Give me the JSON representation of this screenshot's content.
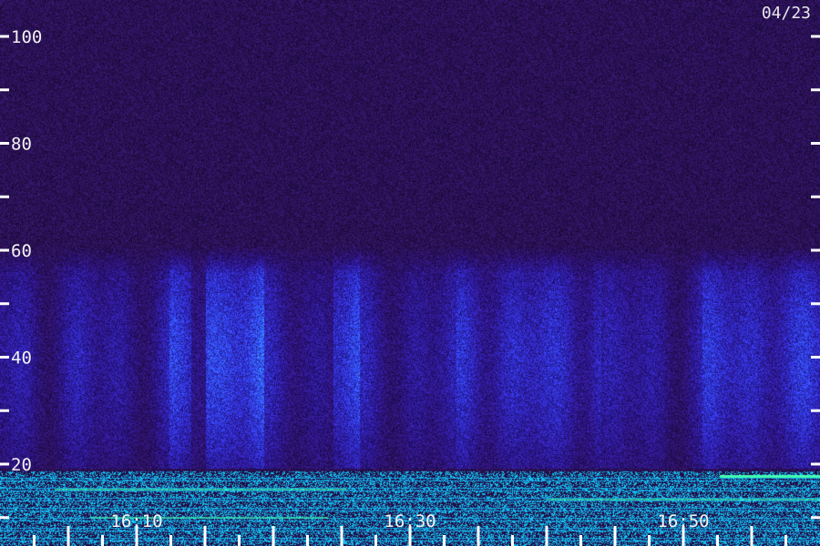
{
  "chart_data": {
    "type": "heatmap",
    "title": "",
    "xlabel": "",
    "ylabel": "",
    "date_label": "04/23",
    "y_axis": {
      "ticks": [
        10,
        20,
        30,
        40,
        50,
        60,
        70,
        80,
        90,
        100,
        110
      ],
      "labels": [
        {
          "value": 20,
          "text": "20"
        },
        {
          "value": 40,
          "text": "40"
        },
        {
          "value": 60,
          "text": "60"
        },
        {
          "value": 80,
          "text": "80"
        },
        {
          "value": 100,
          "text": "100"
        }
      ],
      "range": [
        3,
        105
      ]
    },
    "x_axis": {
      "range_minutes": [
        0,
        60
      ],
      "ticks_minutes": [
        2.5,
        5,
        7.5,
        10,
        12.5,
        15,
        17.5,
        20,
        22.5,
        25,
        27.5,
        30,
        32.5,
        35,
        37.5,
        40,
        42.5,
        45,
        47.5,
        50,
        52.5,
        55,
        57.5
      ],
      "labels": [
        {
          "value": 10,
          "text": "16:10"
        },
        {
          "value": 30,
          "text": "16:30"
        },
        {
          "value": 50,
          "text": "16:50"
        }
      ]
    },
    "colors": {
      "background": "#1b0b42",
      "mid": "#2a2fb8",
      "high": "#3a7cff",
      "band": "#44ffb0"
    }
  }
}
